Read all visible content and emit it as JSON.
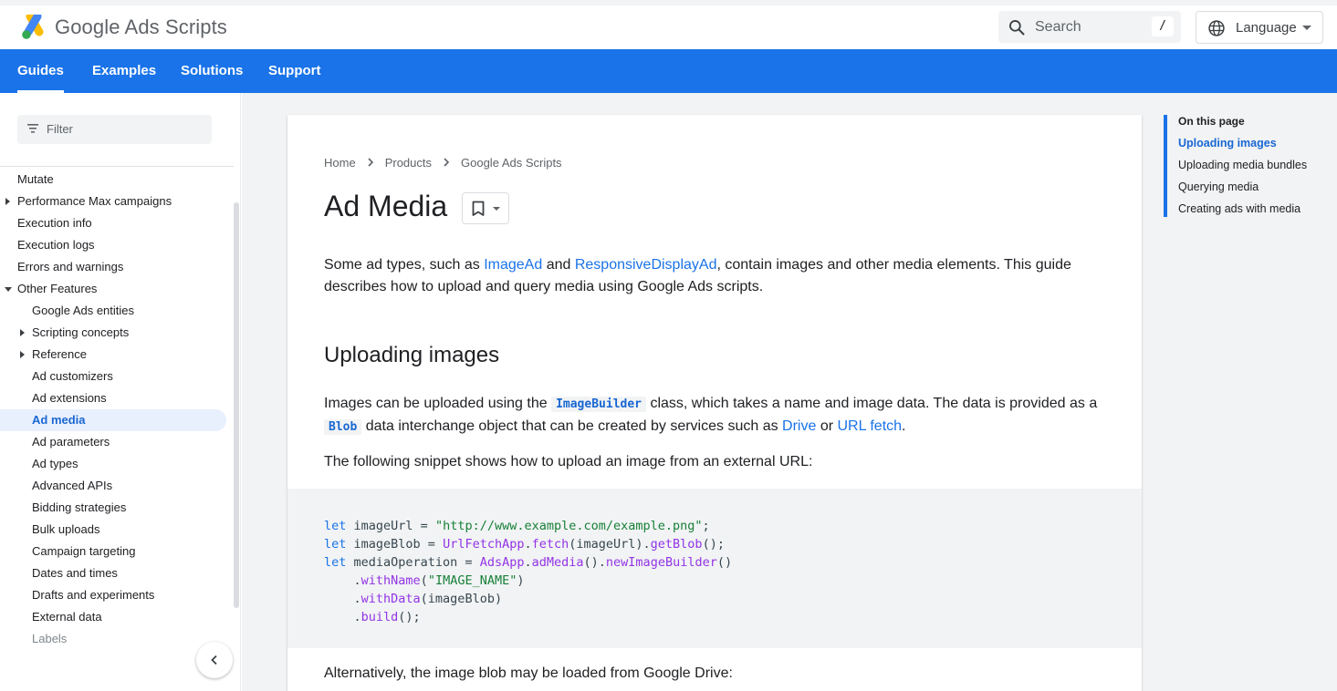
{
  "header": {
    "product": "Google Ads Scripts",
    "search": {
      "label": "Search",
      "shortcut": "/"
    },
    "language": {
      "label": "Language"
    }
  },
  "nav": {
    "tabs": [
      {
        "label": "Guides",
        "active": true
      },
      {
        "label": "Examples"
      },
      {
        "label": "Solutions"
      },
      {
        "label": "Support"
      }
    ]
  },
  "sidebar": {
    "filter_placeholder": "Filter",
    "items": [
      {
        "label": "Mutate"
      },
      {
        "label": "Performance Max campaigns"
      },
      {
        "label": "Execution info"
      },
      {
        "label": "Execution logs"
      },
      {
        "label": "Errors and warnings"
      },
      {
        "label": "Other Features"
      },
      {
        "label": "Google Ads entities"
      },
      {
        "label": "Scripting concepts"
      },
      {
        "label": "Reference"
      },
      {
        "label": "Ad customizers"
      },
      {
        "label": "Ad extensions"
      },
      {
        "label": "Ad media"
      },
      {
        "label": "Ad parameters"
      },
      {
        "label": "Ad types"
      },
      {
        "label": "Advanced APIs"
      },
      {
        "label": "Bidding strategies"
      },
      {
        "label": "Bulk uploads"
      },
      {
        "label": "Campaign targeting"
      },
      {
        "label": "Dates and times"
      },
      {
        "label": "Drafts and experiments"
      },
      {
        "label": "External data"
      },
      {
        "label": "Labels"
      }
    ]
  },
  "breadcrumb": [
    "Home",
    "Products",
    "Google Ads Scripts"
  ],
  "page": {
    "title": "Ad Media",
    "intro": {
      "p1": "Some ad types, such as ",
      "link1": "ImageAd",
      "p2": " and ",
      "link2": "ResponsiveDisplayAd",
      "p3": ", contain images and other media elements. This guide describes how to upload and query media using Google Ads scripts."
    },
    "section_title": "Uploading images",
    "para2": {
      "p1": "Images can be uploaded using the ",
      "code1": "ImageBuilder",
      "p2": " class, which takes a name and image data. The data is provided as a ",
      "code2": "Blob",
      "p3": " data interchange object that can be created by services such as ",
      "link1": "Drive",
      "p4": " or ",
      "link2": "URL fetch",
      "p5": "."
    },
    "para3": "The following snippet shows how to upload an image from an external URL:",
    "para4": "Alternatively, the image blob may be loaded from Google Drive:"
  },
  "code": {
    "l1_kw": "let",
    "l1_var": " imageUrl = ",
    "l1_str": "\"http://www.example.com/example.png\"",
    "l1_end": ";",
    "l2_kw": "let",
    "l2_var": " imageBlob = ",
    "l2_typ": "UrlFetchApp",
    "l2_dot": ".",
    "l2_fn": "fetch",
    "l2_arg": "(imageUrl).",
    "l2_fn2": "getBlob",
    "l2_end": "();",
    "l3_kw": "let",
    "l3_var": " mediaOperation = ",
    "l3_typ": "AdsApp",
    "l3_dot": ".",
    "l3_fn": "adMedia",
    "l3_mid": "().",
    "l3_fn2": "newImageBuilder",
    "l3_end": "()",
    "l4_dot": "    .",
    "l4_fn": "withName",
    "l4_open": "(",
    "l4_str": "\"IMAGE_NAME\"",
    "l4_close": ")",
    "l5_dot": "    .",
    "l5_fn": "withData",
    "l5_arg": "(imageBlob)",
    "l6_dot": "    .",
    "l6_fn": "build",
    "l6_end": "();"
  },
  "toc": {
    "title": "On this page",
    "items": [
      {
        "label": "Uploading images",
        "active": true
      },
      {
        "label": "Uploading media bundles"
      },
      {
        "label": "Querying media"
      },
      {
        "label": "Creating ads with media"
      }
    ]
  }
}
